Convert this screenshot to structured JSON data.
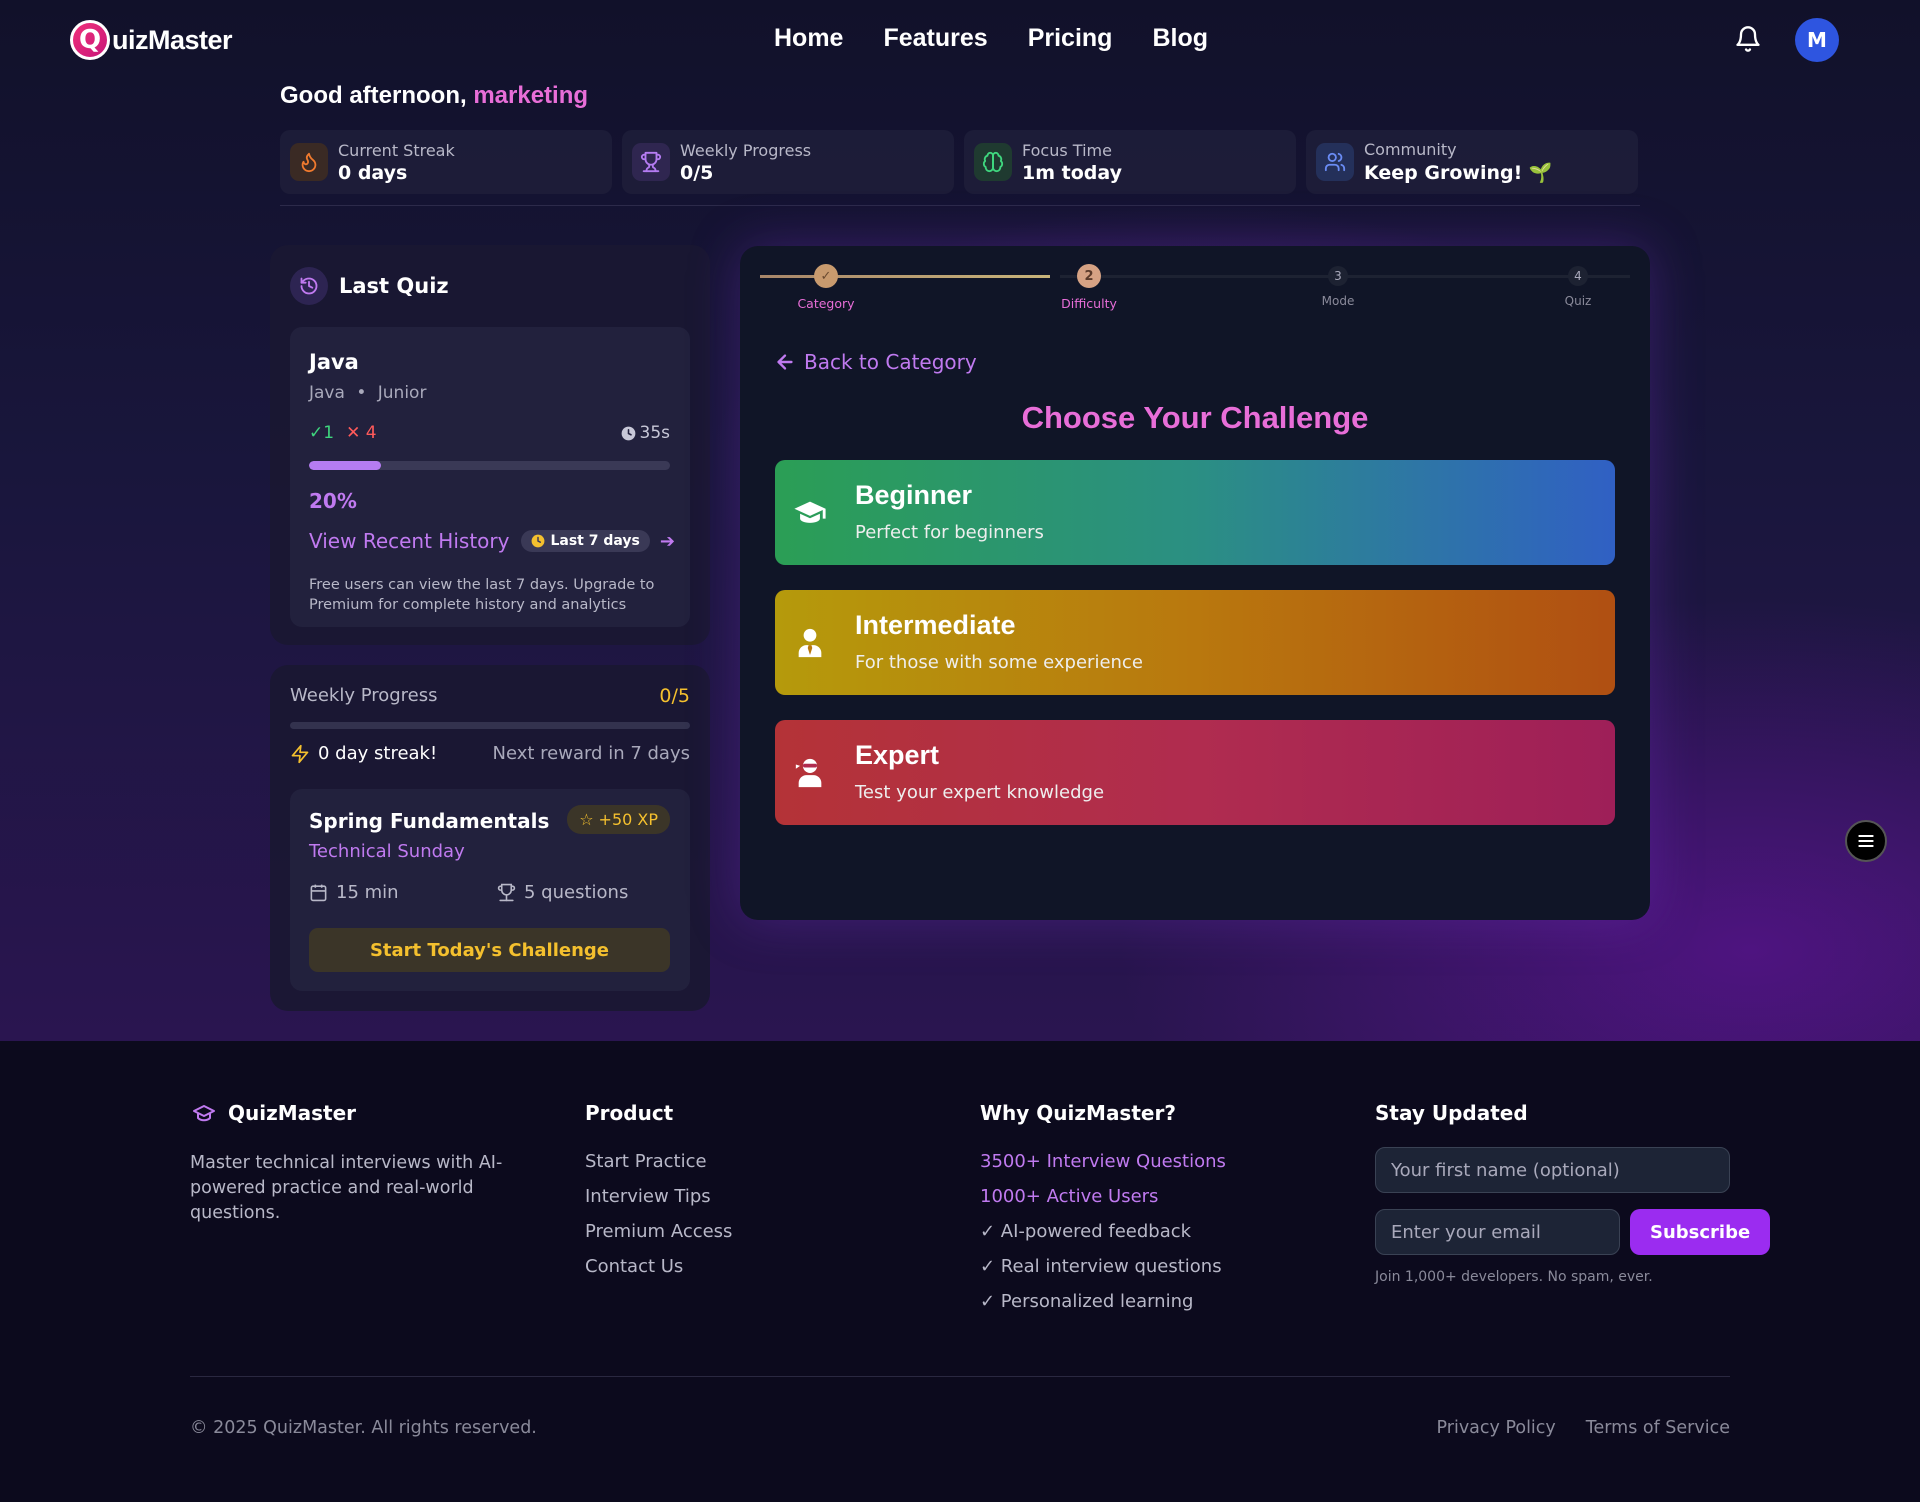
{
  "nav": {
    "logo_letter": "Q",
    "logo_text": "uizMaster",
    "links": [
      "Home",
      "Features",
      "Pricing",
      "Blog"
    ],
    "avatar_initial": "M"
  },
  "greeting": {
    "prefix": "Good afternoon,",
    "name": "marketing"
  },
  "stats": [
    {
      "label": "Current Streak",
      "value": "0 days",
      "icon": "flame-icon",
      "color": "#f07a2e"
    },
    {
      "label": "Weekly Progress",
      "value": "0/5",
      "icon": "trophy-icon",
      "color": "#b57cf2"
    },
    {
      "label": "Focus Time",
      "value": "1m today",
      "icon": "brain-icon",
      "color": "#3fd67e"
    },
    {
      "label": "Community",
      "value": "Keep Growing! 🌱",
      "icon": "users-icon",
      "color": "#6a8cf5"
    }
  ],
  "last_quiz": {
    "title": "Last Quiz",
    "quiz_name": "Java",
    "subject": "Java",
    "level": "Junior",
    "correct": "1",
    "wrong": "4",
    "time": "35s",
    "progress": 0.2,
    "percent": "20%",
    "history_link": "View Recent History",
    "history_badge": "Last 7 days",
    "note": "Free users can view the last 7 days. Upgrade to Premium for complete history and analytics"
  },
  "weekly": {
    "label": "Weekly Progress",
    "value": "0/5",
    "progress": 0,
    "streak": "0 day streak!",
    "next_reward": "Next reward in 7 days",
    "challenge": {
      "title": "Spring Fundamentals",
      "xp": "+50 XP",
      "subtitle": "Technical Sunday",
      "duration": "15 min",
      "questions": "5 questions",
      "button": "Start Today's Challenge"
    }
  },
  "stepper": {
    "steps": [
      {
        "num": "✓",
        "label": "Category",
        "state": "done"
      },
      {
        "num": "2",
        "label": "Difficulty",
        "state": "active"
      },
      {
        "num": "3",
        "label": "Mode",
        "state": "todo"
      },
      {
        "num": "4",
        "label": "Quiz",
        "state": "todo"
      }
    ]
  },
  "main": {
    "back_label": "Back to Category",
    "heading": "Choose Your Challenge",
    "levels": [
      {
        "name": "Beginner",
        "desc": "Perfect for beginners",
        "icon": "graduation-cap-icon"
      },
      {
        "name": "Intermediate",
        "desc": "For those with some experience",
        "icon": "user-tie-icon"
      },
      {
        "name": "Expert",
        "desc": "Test your expert knowledge",
        "icon": "user-ninja-icon"
      }
    ]
  },
  "footer": {
    "brand": "QuizMaster",
    "description": "Master technical interviews with AI-powered practice and real-world questions.",
    "product_head": "Product",
    "product_links": [
      "Start Practice",
      "Interview Tips",
      "Premium Access",
      "Contact Us"
    ],
    "why_head": "Why QuizMaster?",
    "why_items": [
      "3500+ Interview Questions",
      "1000+ Active Users",
      "✓ AI-powered feedback",
      "✓ Real interview questions",
      "✓ Personalized learning"
    ],
    "stay_head": "Stay Updated",
    "name_placeholder": "Your first name (optional)",
    "email_placeholder": "Enter your email",
    "subscribe": "Subscribe",
    "small_note": "Join 1,000+ developers. No spam, ever.",
    "copyright": "© 2025 QuizMaster. All rights reserved.",
    "privacy": "Privacy Policy",
    "terms": "Terms of Service"
  }
}
